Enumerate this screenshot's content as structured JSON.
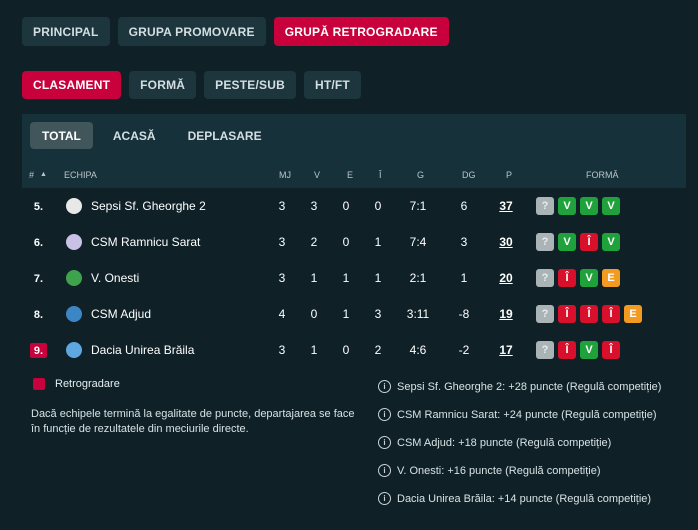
{
  "tabs_main": [
    "PRINCIPAL",
    "GRUPA PROMOVARE",
    "GRUPĂ RETROGRADARE"
  ],
  "tabs_sub": [
    "CLASAMENT",
    "FORMĂ",
    "PESTE/SUB",
    "HT/FT"
  ],
  "tabs_venue": [
    "TOTAL",
    "ACASĂ",
    "DEPLASARE"
  ],
  "header": {
    "rank": "#",
    "sort_icon": "▲",
    "team": "ECHIPA",
    "mj": "MJ",
    "v": "V",
    "e": "E",
    "i": "Î",
    "g": "G",
    "dg": "DG",
    "p": "P",
    "form": "FORMĂ"
  },
  "rows": [
    {
      "pos": "5.",
      "team": "Sepsi Sf. Gheorghe 2",
      "mj": "3",
      "v": "3",
      "e": "0",
      "i": "0",
      "g": "7:1",
      "dg": "6",
      "p": "37",
      "form": [
        "?",
        "V",
        "V",
        "V"
      ],
      "rel": false,
      "logo_color": "#e8e8e8"
    },
    {
      "pos": "6.",
      "team": "CSM Ramnicu Sarat",
      "mj": "3",
      "v": "2",
      "e": "0",
      "i": "1",
      "g": "7:4",
      "dg": "3",
      "p": "30",
      "form": [
        "?",
        "V",
        "Î",
        "V"
      ],
      "rel": false,
      "logo_color": "#c9c1e6"
    },
    {
      "pos": "7.",
      "team": "V. Onesti",
      "mj": "3",
      "v": "1",
      "e": "1",
      "i": "1",
      "g": "2:1",
      "dg": "1",
      "p": "20",
      "form": [
        "?",
        "Î",
        "V",
        "E"
      ],
      "rel": false,
      "logo_color": "#3fa34d"
    },
    {
      "pos": "8.",
      "team": "CSM Adjud",
      "mj": "4",
      "v": "0",
      "e": "1",
      "i": "3",
      "g": "3:11",
      "dg": "-8",
      "p": "19",
      "form": [
        "?",
        "Î",
        "Î",
        "Î",
        "E"
      ],
      "rel": false,
      "logo_color": "#3d86c6"
    },
    {
      "pos": "9.",
      "team": "Dacia Unirea Brăila",
      "mj": "3",
      "v": "1",
      "e": "0",
      "i": "2",
      "g": "4:6",
      "dg": "-2",
      "p": "17",
      "form": [
        "?",
        "Î",
        "V",
        "Î"
      ],
      "rel": true,
      "logo_color": "#5fa7e0"
    }
  ],
  "legend": {
    "label": "Retrogradare",
    "color": "#c8003c"
  },
  "note": "Dacă echipele termină la egalitate de puncte, departajarea se face în funcție de rezultatele din meciurile directe.",
  "info_icon": "i",
  "penalties": [
    "Sepsi Sf. Gheorghe 2: +28 puncte (Regulă competiție)",
    "CSM Ramnicu Sarat: +24 puncte (Regulă competiție)",
    "CSM Adjud: +18 puncte (Regulă competiție)",
    "V. Onesti: +16 puncte (Regulă competiție)",
    "Dacia Unirea Brăila: +14 puncte (Regulă competiție)"
  ]
}
